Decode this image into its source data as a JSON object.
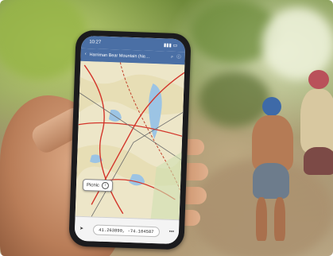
{
  "phone": {
    "status_time": "10:27",
    "map_title": "Harriman Bear Mountain (Ne…",
    "popup_label": "Picnic",
    "coordinates": "41.263890, -74.104587"
  },
  "colors": {
    "header_blue": "#4a6fa5",
    "map_base": "#ede6c8",
    "map_water": "#9cc4e4",
    "trail_red": "#d3352a"
  },
  "icons": {
    "back": "back-chevron-icon",
    "search": "search-icon",
    "info": "info-icon",
    "location": "location-arrow-icon",
    "more": "more-icon"
  }
}
